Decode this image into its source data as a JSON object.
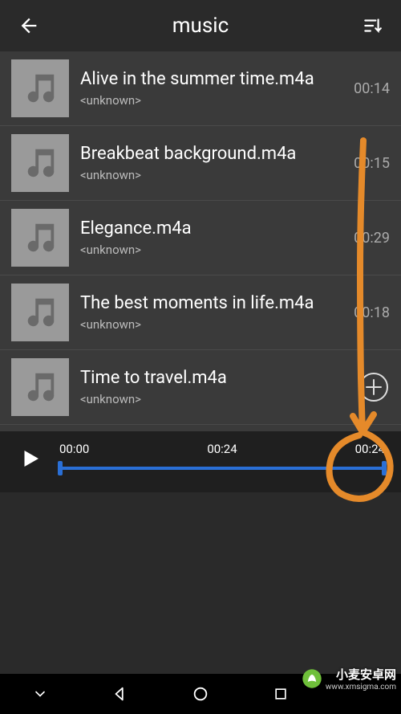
{
  "header": {
    "title": "music"
  },
  "tracks": [
    {
      "title": "Alive in the summer time.m4a",
      "artist": "<unknown>",
      "duration": "00:14"
    },
    {
      "title": "Breakbeat background.m4a",
      "artist": "<unknown>",
      "duration": "00:15"
    },
    {
      "title": "Elegance.m4a",
      "artist": "<unknown>",
      "duration": "00:29"
    },
    {
      "title": "The best moments in life.m4a",
      "artist": "<unknown>",
      "duration": "00:18"
    },
    {
      "title": "Time to travel.m4a",
      "artist": "<unknown>",
      "duration": ""
    }
  ],
  "player": {
    "start": "00:00",
    "mid": "00:24",
    "end": "00:24"
  },
  "watermark": {
    "line1": "小麦安卓网",
    "line2": "www.xmsigma.com"
  }
}
